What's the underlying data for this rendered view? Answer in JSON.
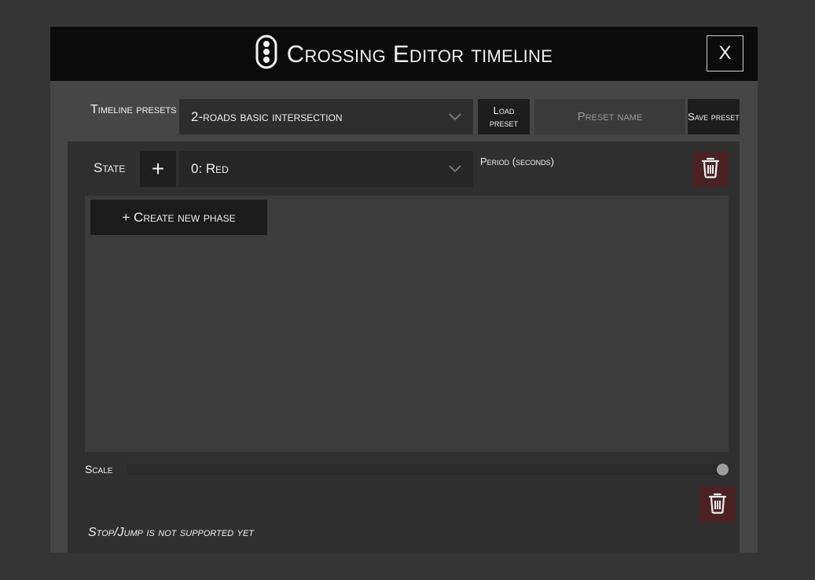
{
  "window": {
    "title": "Crossing Editor timeline",
    "title_icon": "traffic-light-icon",
    "close_label": "X"
  },
  "presets": {
    "label": "Timeline presets",
    "selected": "2-roads basic intersection",
    "load_label": "Load preset",
    "name_placeholder": "Preset name",
    "save_label": "Save preset"
  },
  "state": {
    "label": "State",
    "add_label": "+",
    "selected": "0: Red",
    "period_label": "Period (seconds)",
    "delete_icon": "trash-icon"
  },
  "timeline": {
    "create_phase_label": "+ Create new phase"
  },
  "scale": {
    "label": "Scale",
    "value_fraction": 1.0
  },
  "footer": {
    "warning": "Stop/Jump is not supported yet"
  },
  "colors": {
    "background": "#353535",
    "titlebar": "#0b0b0b",
    "delete_button": "#4a2224"
  }
}
